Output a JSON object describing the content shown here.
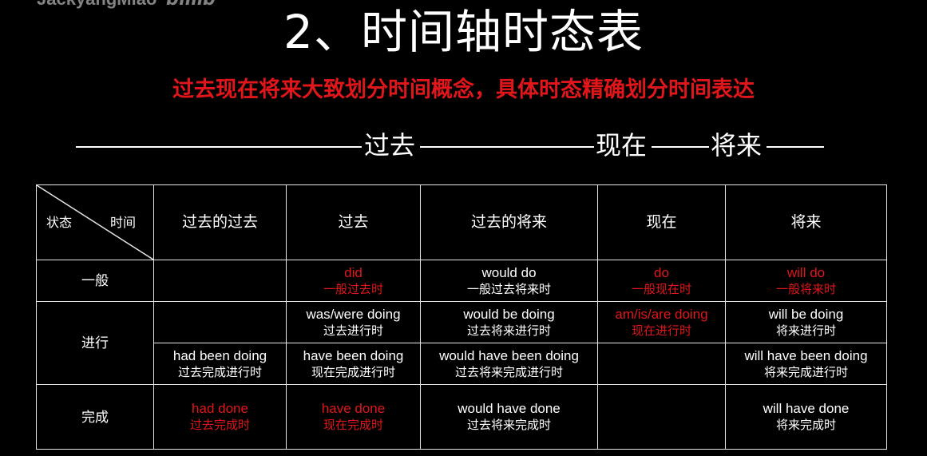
{
  "watermark": {
    "text": "JackyangMiao",
    "logo": "bilibili"
  },
  "title": "2、时间轴时态表",
  "subtitle": "过去现在将来大致划分时间概念，具体时态精确划分时间表达",
  "timeline": {
    "past": "过去",
    "present": "现在",
    "future": "将来"
  },
  "table": {
    "corner": {
      "state": "状态",
      "time": "时间"
    },
    "columns": [
      "过去的过去",
      "过去",
      "过去的将来",
      "现在",
      "将来"
    ],
    "rows": {
      "simple": "一般",
      "progressive": "进行",
      "perfect": "完成"
    },
    "cells": {
      "simple_past": {
        "form": "did",
        "name": "一般过去时"
      },
      "simple_past_future": {
        "form": "would do",
        "name": "一般过去将来时"
      },
      "simple_present": {
        "form": "do",
        "name": "一般现在时"
      },
      "simple_future": {
        "form": "will do",
        "name": "一般将来时"
      },
      "prog_past": {
        "form": "was/were doing",
        "name": "过去进行时"
      },
      "prog_past_future": {
        "form": "would be doing",
        "name": "过去将来进行时"
      },
      "prog_present": {
        "form": "am/is/are doing",
        "name": "现在进行时"
      },
      "prog_future": {
        "form": "will be doing",
        "name": "将来进行时"
      },
      "perfprog_pastpast": {
        "form": "had been doing",
        "name": "过去完成进行时"
      },
      "perfprog_past": {
        "form": "have been doing",
        "name": "现在完成进行时"
      },
      "perfprog_past_future": {
        "form": "would have been doing",
        "name": "过去将来完成进行时"
      },
      "perfprog_future": {
        "form": "will have been doing",
        "name": "将来完成进行时"
      },
      "perf_pastpast": {
        "form": "had done",
        "name": "过去完成时"
      },
      "perf_past": {
        "form": "have done",
        "name": "现在完成时"
      },
      "perf_past_future": {
        "form": "would have done",
        "name": "过去将来完成时"
      },
      "perf_future": {
        "form": "will have done",
        "name": "将来完成时"
      }
    }
  },
  "colors": {
    "background": "#000000",
    "text": "#ffffff",
    "accent_red": "#e0161b"
  }
}
